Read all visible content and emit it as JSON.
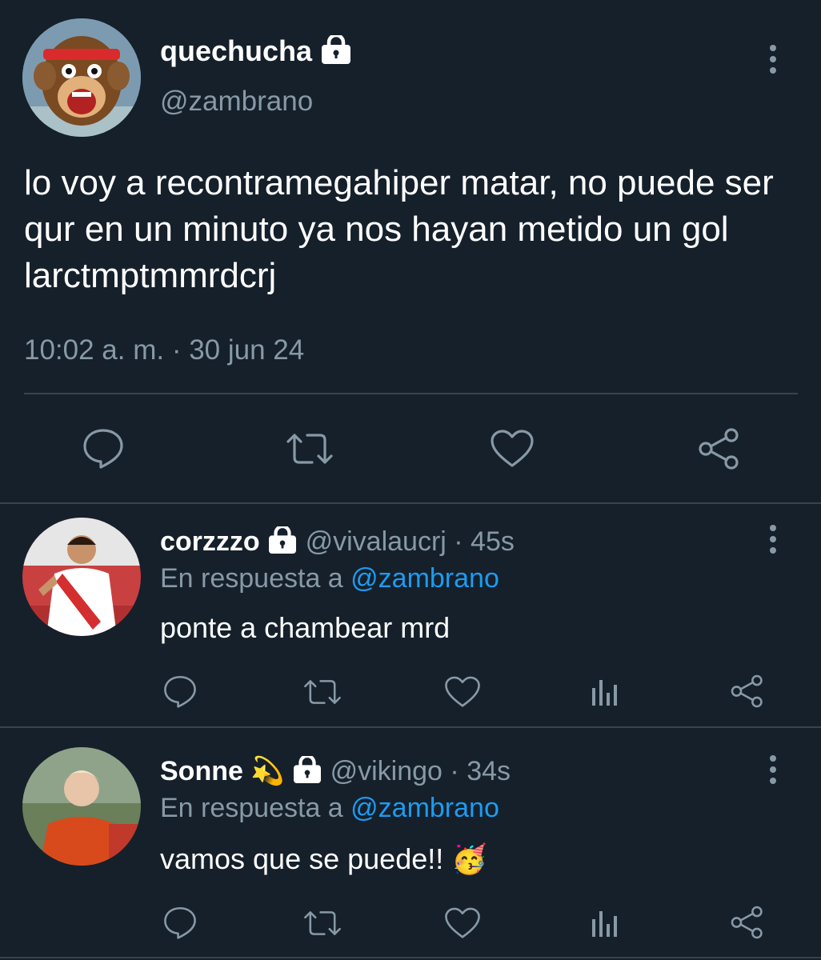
{
  "main_tweet": {
    "display_name": "quechucha",
    "handle": "@zambrano",
    "text": "lo voy a recontramegahiper matar, no puede ser qur en un minuto ya nos hayan metido un gol larctmptmmrdcrj",
    "timestamp": "10:02 a. m. · 30 jun 24",
    "protected": true,
    "actions": [
      "reply-icon",
      "retweet-icon",
      "like-icon",
      "share-icon"
    ]
  },
  "replies": [
    {
      "display_name": "corzzzo",
      "handle": "@vivalaucrj",
      "time": "· 45s",
      "reply_prefix": "En respuesta a",
      "reply_to": "@zambrano",
      "text": "ponte a chambear mrd",
      "protected": true
    },
    {
      "display_name": "Sonne",
      "handle": "@vikingo",
      "time": "· 34s",
      "reply_prefix": "En respuesta a",
      "reply_to": "@zambrano",
      "text": "vamos que se puede!! 🥳",
      "name_emoji": "💫",
      "protected": true
    }
  ],
  "colors": {
    "background": "#15202b",
    "muted": "#8899a6",
    "link": "#1d9bf0",
    "divider": "#38444d"
  }
}
